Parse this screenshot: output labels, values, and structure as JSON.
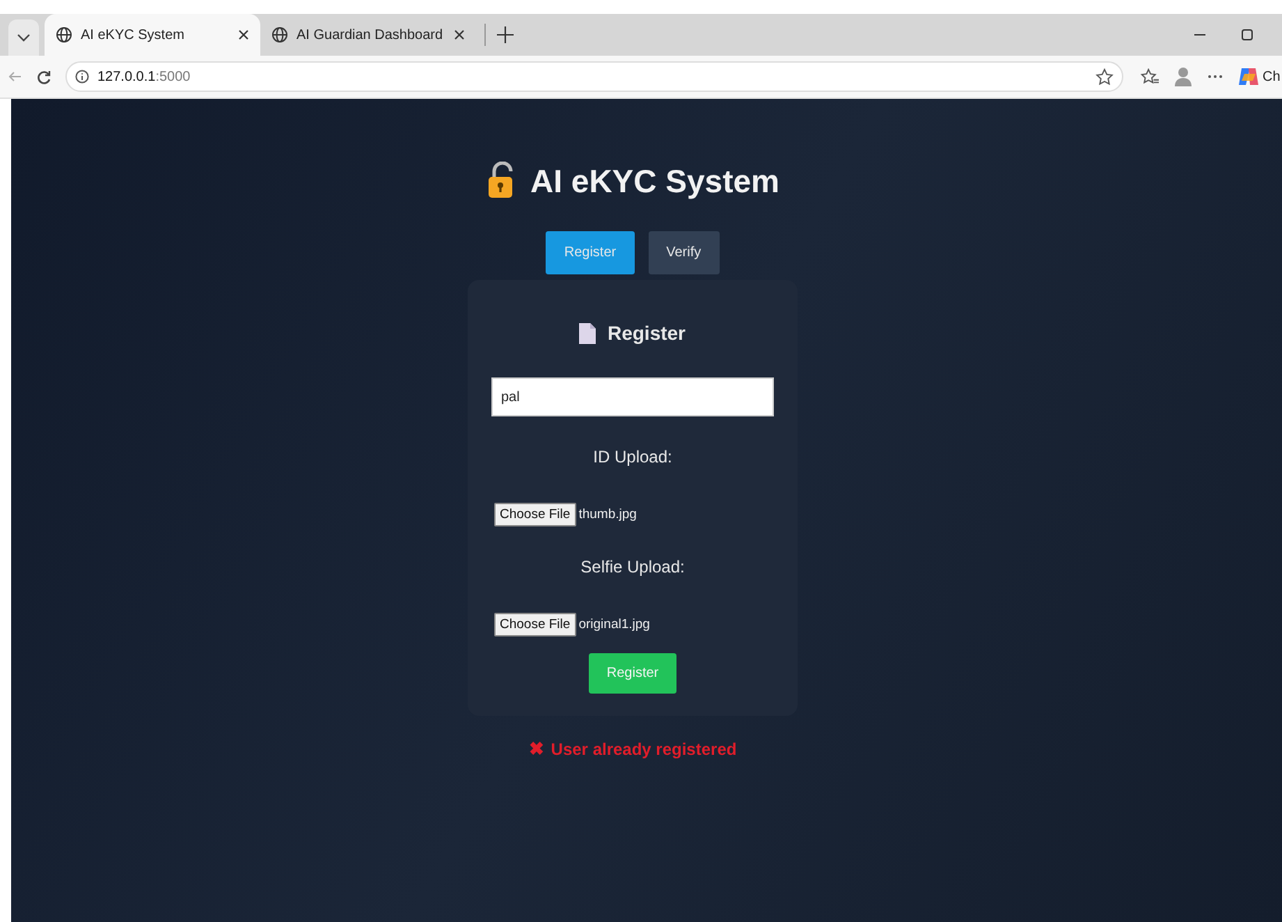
{
  "browser": {
    "tabs": [
      {
        "title": "AI eKYC System",
        "selected": true
      },
      {
        "title": "AI Guardian Dashboard",
        "selected": false
      }
    ],
    "url_host": "127.0.0.1",
    "url_port": ":5000",
    "copilot_label": "Ch"
  },
  "page": {
    "title": "AI eKYC System",
    "tabs": [
      {
        "label": "Register",
        "selected": true
      },
      {
        "label": "Verify",
        "selected": false
      }
    ],
    "form": {
      "title": "Register",
      "name_value": "pal",
      "uploads": [
        {
          "label": "ID Upload:",
          "button": "Choose File",
          "file": "thumb.jpg"
        },
        {
          "label": "Selfie Upload:",
          "button": "Choose File",
          "file": "original1.jpg"
        }
      ],
      "submit": "Register"
    },
    "message": {
      "kind": "error",
      "icon": "✖",
      "text": "User already registered"
    }
  }
}
